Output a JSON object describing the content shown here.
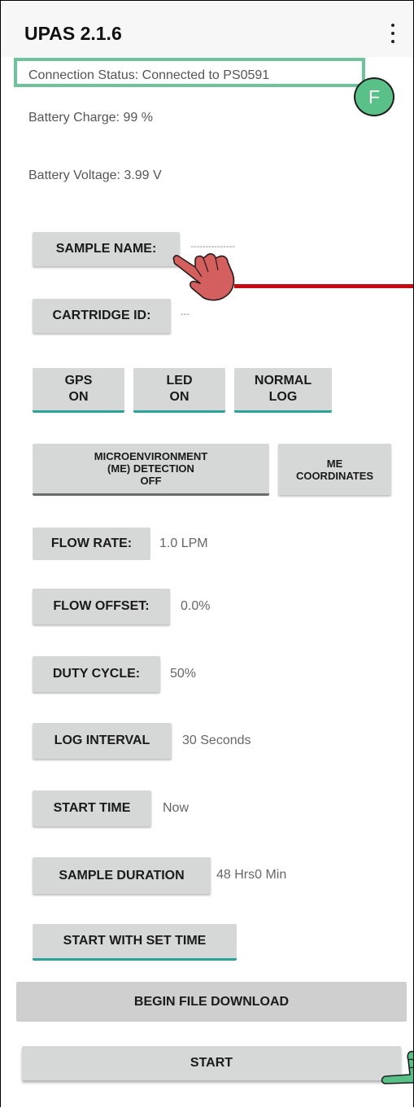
{
  "app_title": "UPAS 2.1.6",
  "overflow_icon": "more-vert-icon",
  "connection_status": "Connection Status: Connected to PS0591",
  "annotation_badge": "F",
  "battery_charge": "Battery Charge: 99 %",
  "battery_voltage": "Battery Voltage: 3.99 V",
  "sample_name": {
    "label": "SAMPLE NAME:",
    "value": "---------------"
  },
  "cartridge_id": {
    "label": "CARTRIDGE ID:",
    "value": "---"
  },
  "toggles": {
    "gps": {
      "line1": "GPS",
      "line2": "ON"
    },
    "led": {
      "line1": "LED",
      "line2": "ON"
    },
    "log": {
      "line1": "NORMAL",
      "line2": "LOG"
    }
  },
  "me_detection": {
    "line1": "MICROENVIRONMENT",
    "line2": "(ME) DETECTION",
    "line3": "OFF"
  },
  "me_coordinates": {
    "line1": "ME",
    "line2": "COORDINATES"
  },
  "flow_rate": {
    "label": "FLOW RATE:",
    "value": "1.0 LPM"
  },
  "flow_offset": {
    "label": "FLOW OFFSET:",
    "value": "0.0%"
  },
  "duty_cycle": {
    "label": "DUTY CYCLE:",
    "value": "50%"
  },
  "log_interval": {
    "label": "LOG INTERVAL",
    "value": "30 Seconds"
  },
  "start_time": {
    "label": "START TIME",
    "value": "Now"
  },
  "sample_duration": {
    "label": "SAMPLE DURATION",
    "value": "48 Hrs0 Min"
  },
  "start_with_set_time": "START WITH SET TIME",
  "begin_file_download": "BEGIN FILE DOWNLOAD",
  "start": "START",
  "colors": {
    "highlight_box": "#6cc59a",
    "badge": "#59c187",
    "pointer_hand": "#d35f5f",
    "pointer_line": "#c40d12",
    "green_hand": "#59c187",
    "toggle_underline": "#2aa39a"
  }
}
